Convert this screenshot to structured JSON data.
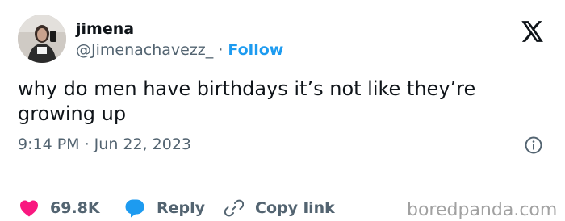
{
  "author": {
    "display_name": "jimena",
    "handle": "@Jimenachavezz_",
    "separator": "·",
    "follow_label": "Follow"
  },
  "tweet": {
    "text": "why do men have birthdays it’s not like they’re growing up",
    "timestamp": "9:14 PM · Jun 22, 2023"
  },
  "actions": {
    "likes": "69.8K",
    "reply_label": "Reply",
    "copy_link_label": "Copy link"
  },
  "watermark": "boredpanda.com",
  "icons": {
    "brand_logo": "x-logo-icon",
    "info": "info-icon",
    "like": "heart-icon",
    "reply": "speech-bubble-icon",
    "copy_link": "link-icon"
  },
  "colors": {
    "text_primary": "#0f1419",
    "text_secondary": "#536471",
    "link_blue": "#1d9bf0",
    "like_pink": "#f91880",
    "watermark_gray": "#a1a1a1"
  }
}
